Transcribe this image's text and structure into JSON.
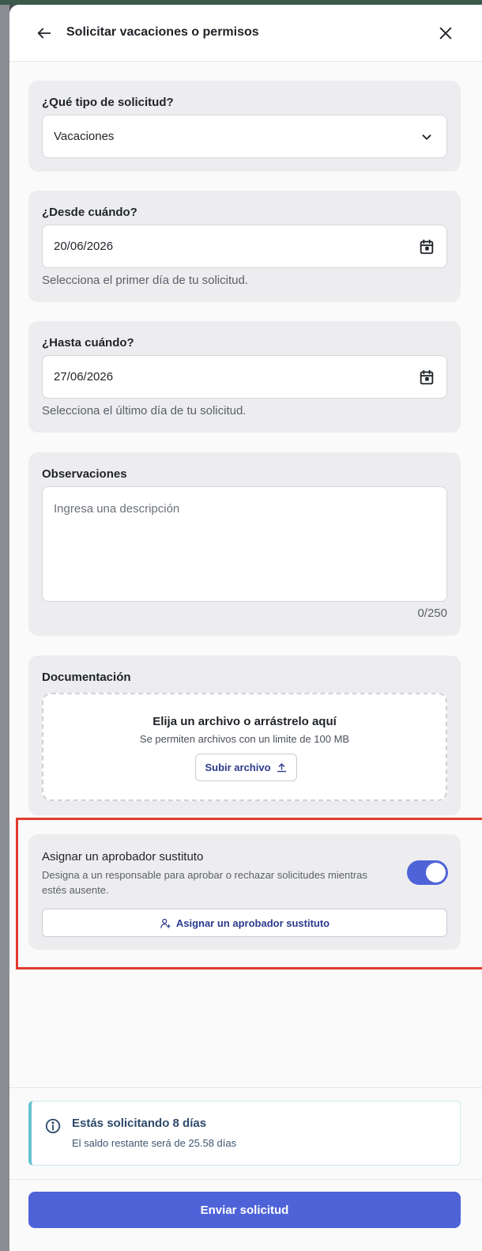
{
  "header": {
    "title": "Solicitar vacaciones o permisos"
  },
  "type_section": {
    "label": "¿Qué tipo de solicitud?",
    "value": "Vacaciones"
  },
  "from_section": {
    "label": "¿Desde cuándo?",
    "value": "20/06/2026",
    "helper": "Selecciona el primer día de tu solicitud."
  },
  "to_section": {
    "label": "¿Hasta cuándo?",
    "value": "27/06/2026",
    "helper": "Selecciona el último día de tu solicitud."
  },
  "notes_section": {
    "label": "Observaciones",
    "placeholder": "Ingresa una descripción",
    "counter": "0/250"
  },
  "docs_section": {
    "label": "Documentación",
    "drop_title": "Elija un archivo o arrástrelo aquí",
    "drop_sub": "Se permiten archivos con un limite de 100 MB",
    "upload_label": "Subir archivo"
  },
  "substitute_section": {
    "title": "Asignar un aprobador sustituto",
    "description": "Designa a un responsable para aprobar o rechazar solicitudes mientras estés ausente.",
    "toggle_on": true,
    "button_label": "Asignar un aprobador sustituto"
  },
  "info": {
    "title": "Estás solicitando 8 días",
    "sub": "El saldo restante será de 25.58 días"
  },
  "submit_label": "Enviar solicitud",
  "colors": {
    "primary": "#4f63d8",
    "highlight": "#e23b2e",
    "info_accent": "#67c2cf"
  }
}
